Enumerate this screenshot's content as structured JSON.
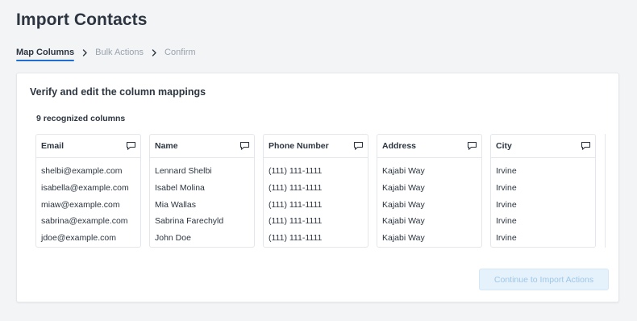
{
  "page": {
    "title": "Import Contacts"
  },
  "steps": [
    {
      "label": "Map Columns",
      "active": true
    },
    {
      "label": "Bulk Actions",
      "active": false
    },
    {
      "label": "Confirm",
      "active": false
    }
  ],
  "card": {
    "title": "Verify and edit the column mappings",
    "recognized": "9 recognized columns",
    "columns": [
      {
        "header": "Email",
        "values": [
          "shelbi@example.com",
          "isabella@example.com",
          "miaw@example.com",
          "sabrina@example.com",
          "jdoe@example.com"
        ]
      },
      {
        "header": "Name",
        "values": [
          "Lennard Shelbi",
          "Isabel Molina",
          "Mia Wallas",
          "Sabrina Farechyld",
          "John Doe"
        ]
      },
      {
        "header": "Phone Number",
        "values": [
          "(111) 111-1111",
          "(111) 111-1111",
          "(111) 111-1111",
          "(111) 111-1111",
          "(111) 111-1111"
        ]
      },
      {
        "header": "Address",
        "values": [
          "Kajabi Way",
          "Kajabi Way",
          "Kajabi Way",
          "Kajabi Way",
          "Kajabi Way"
        ]
      },
      {
        "header": "City",
        "values": [
          "Irvine",
          "Irvine",
          "Irvine",
          "Irvine",
          "Irvine"
        ]
      }
    ],
    "continue_label": "Continue to Import Actions"
  },
  "colors": {
    "accent": "#1f6fd0",
    "text": "#2c3540",
    "muted": "#9aa3ad",
    "button_disabled_bg": "#e6f2fb",
    "button_disabled_text": "#9dc6e8"
  },
  "icons": {
    "step_separator": "chevron-right-icon",
    "column_edit": "edit-mapping-icon"
  }
}
